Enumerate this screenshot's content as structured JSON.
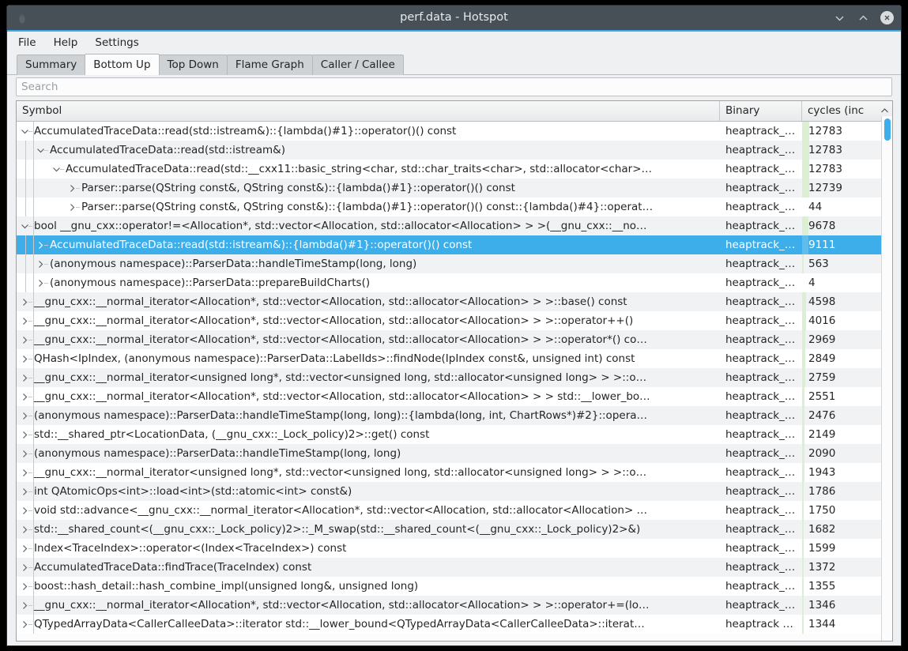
{
  "window": {
    "title": "perf.data - Hotspot",
    "app_icon": "flame-icon",
    "controls": {
      "minimize": "minimize-icon",
      "maximize": "maximize-icon",
      "close": "close-icon"
    }
  },
  "menubar": {
    "items": [
      {
        "label": "File"
      },
      {
        "label": "Help"
      },
      {
        "label": "Settings"
      }
    ]
  },
  "tabs": {
    "active": "Bottom Up",
    "items": [
      {
        "label": "Summary"
      },
      {
        "label": "Bottom Up"
      },
      {
        "label": "Top Down"
      },
      {
        "label": "Flame Graph"
      },
      {
        "label": "Caller / Callee"
      }
    ]
  },
  "search": {
    "value": "",
    "placeholder": "Search"
  },
  "table": {
    "columns": [
      {
        "key": "symbol",
        "label": "Symbol"
      },
      {
        "key": "binary",
        "label": "Binary"
      },
      {
        "key": "cycles",
        "label": "cycles (inc",
        "sort": "ascending",
        "sort_glyph": "⌃"
      }
    ],
    "colors": {
      "selection": "#3daee9",
      "cost_bar": "#dcefd2",
      "row_alt": "#f1f2f3",
      "accent": "#3daee9"
    },
    "rows": [
      {
        "depth": 0,
        "state": "expanded",
        "symbol": "AccumulatedTraceData::read(std::istream&)::{lambda()#1}::operator()() const",
        "binary": "heaptrack_…",
        "cycles": "12783",
        "bar": 9
      },
      {
        "depth": 1,
        "state": "expanded",
        "symbol": "AccumulatedTraceData::read(std::istream&)",
        "binary": "heaptrack_…",
        "cycles": "12783",
        "bar": 9
      },
      {
        "depth": 2,
        "state": "expanded",
        "symbol": "AccumulatedTraceData::read(std::__cxx11::basic_string<char, std::char_traits<char>, std::allocator<char>…",
        "binary": "heaptrack_…",
        "cycles": "12783",
        "bar": 9
      },
      {
        "depth": 3,
        "state": "collapsed",
        "symbol": "Parser::parse(QString const&, QString const&)::{lambda()#1}::operator()() const",
        "binary": "heaptrack_…",
        "cycles": "12739",
        "bar": 9
      },
      {
        "depth": 3,
        "state": "collapsed",
        "symbol": "Parser::parse(QString const&, QString const&)::{lambda()#1}::operator()() const::{lambda()#4}::operat…",
        "binary": "heaptrack_…",
        "cycles": "44",
        "bar": 0
      },
      {
        "depth": 0,
        "state": "expanded",
        "symbol": "bool __gnu_cxx::operator!=<Allocation*, std::vector<Allocation, std::allocator<Allocation> > >(__gnu_cxx::__no…",
        "binary": "heaptrack_…",
        "cycles": "9678",
        "bar": 8
      },
      {
        "depth": 1,
        "state": "collapsed",
        "selected": true,
        "symbol": "AccumulatedTraceData::read(std::istream&)::{lambda()#1}::operator()() const",
        "binary": "heaptrack_…",
        "cycles": "9111",
        "bar": 8
      },
      {
        "depth": 1,
        "state": "collapsed",
        "symbol": "(anonymous namespace)::ParserData::handleTimeStamp(long, long)",
        "binary": "heaptrack_…",
        "cycles": "563",
        "bar": 2
      },
      {
        "depth": 1,
        "state": "collapsed",
        "symbol": "(anonymous namespace)::ParserData::prepareBuildCharts()",
        "binary": "heaptrack_…",
        "cycles": "4",
        "bar": 0
      },
      {
        "depth": 0,
        "state": "collapsed",
        "symbol": "__gnu_cxx::__normal_iterator<Allocation*, std::vector<Allocation, std::allocator<Allocation> > >::base() const",
        "binary": "heaptrack_…",
        "cycles": "4598",
        "bar": 5
      },
      {
        "depth": 0,
        "state": "collapsed",
        "symbol": "__gnu_cxx::__normal_iterator<Allocation*, std::vector<Allocation, std::allocator<Allocation> > >::operator++()",
        "binary": "heaptrack_…",
        "cycles": "4016",
        "bar": 5
      },
      {
        "depth": 0,
        "state": "collapsed",
        "symbol": "__gnu_cxx::__normal_iterator<Allocation*, std::vector<Allocation, std::allocator<Allocation> > >::operator*() co…",
        "binary": "heaptrack_…",
        "cycles": "2969",
        "bar": 4
      },
      {
        "depth": 0,
        "state": "collapsed",
        "symbol": "QHash<IpIndex, (anonymous namespace)::ParserData::LabelIds>::findNode(IpIndex const&, unsigned int) const",
        "binary": "heaptrack_…",
        "cycles": "2849",
        "bar": 4
      },
      {
        "depth": 0,
        "state": "collapsed",
        "symbol": "__gnu_cxx::__normal_iterator<unsigned long*, std::vector<unsigned long, std::allocator<unsigned long> > >::o…",
        "binary": "heaptrack_…",
        "cycles": "2759",
        "bar": 4
      },
      {
        "depth": 0,
        "state": "collapsed",
        "symbol": "__gnu_cxx::__normal_iterator<Allocation*, std::vector<Allocation, std::allocator<Allocation> > > std::__lower_bo…",
        "binary": "heaptrack_…",
        "cycles": "2551",
        "bar": 3
      },
      {
        "depth": 0,
        "state": "collapsed",
        "symbol": "(anonymous namespace)::ParserData::handleTimeStamp(long, long)::{lambda(long, int, ChartRows*)#2}::opera…",
        "binary": "heaptrack_…",
        "cycles": "2476",
        "bar": 3
      },
      {
        "depth": 0,
        "state": "collapsed",
        "symbol": "std::__shared_ptr<LocationData, (__gnu_cxx::_Lock_policy)2>::get() const",
        "binary": "heaptrack_…",
        "cycles": "2149",
        "bar": 3
      },
      {
        "depth": 0,
        "state": "collapsed",
        "symbol": "(anonymous namespace)::ParserData::handleTimeStamp(long, long)",
        "binary": "heaptrack_…",
        "cycles": "2090",
        "bar": 3
      },
      {
        "depth": 0,
        "state": "collapsed",
        "symbol": "__gnu_cxx::__normal_iterator<unsigned long*, std::vector<unsigned long, std::allocator<unsigned long> > >::o…",
        "binary": "heaptrack_…",
        "cycles": "1943",
        "bar": 3
      },
      {
        "depth": 0,
        "state": "collapsed",
        "symbol": "int QAtomicOps<int>::load<int>(std::atomic<int> const&)",
        "binary": "heaptrack_…",
        "cycles": "1786",
        "bar": 2
      },
      {
        "depth": 0,
        "state": "collapsed",
        "symbol": "void std::advance<__gnu_cxx::__normal_iterator<Allocation*, std::vector<Allocation, std::allocator<Allocation> …",
        "binary": "heaptrack_…",
        "cycles": "1750",
        "bar": 2
      },
      {
        "depth": 0,
        "state": "collapsed",
        "symbol": "std::__shared_count<(__gnu_cxx::_Lock_policy)2>::_M_swap(std::__shared_count<(__gnu_cxx::_Lock_policy)2>&)",
        "binary": "heaptrack_…",
        "cycles": "1682",
        "bar": 2
      },
      {
        "depth": 0,
        "state": "collapsed",
        "symbol": "Index<TraceIndex>::operator<(Index<TraceIndex>) const",
        "binary": "heaptrack_…",
        "cycles": "1599",
        "bar": 2
      },
      {
        "depth": 0,
        "state": "collapsed",
        "symbol": "AccumulatedTraceData::findTrace(TraceIndex) const",
        "binary": "heaptrack_…",
        "cycles": "1372",
        "bar": 2
      },
      {
        "depth": 0,
        "state": "collapsed",
        "symbol": "boost::hash_detail::hash_combine_impl(unsigned long&, unsigned long)",
        "binary": "heaptrack_…",
        "cycles": "1355",
        "bar": 2
      },
      {
        "depth": 0,
        "state": "collapsed",
        "symbol": "__gnu_cxx::__normal_iterator<Allocation*, std::vector<Allocation, std::allocator<Allocation> > >::operator+=(lo…",
        "binary": "heaptrack_…",
        "cycles": "1346",
        "bar": 2
      },
      {
        "depth": 0,
        "state": "collapsed",
        "symbol": "QTypedArrayData<CallerCalleeData>::iterator std::__lower_bound<QTypedArrayData<CallerCalleeData>::iterat…",
        "binary": "heaptrack …",
        "cycles": "1344",
        "bar": 2
      }
    ]
  },
  "scrollbar": {
    "orientation": "vertical",
    "position": "top"
  }
}
